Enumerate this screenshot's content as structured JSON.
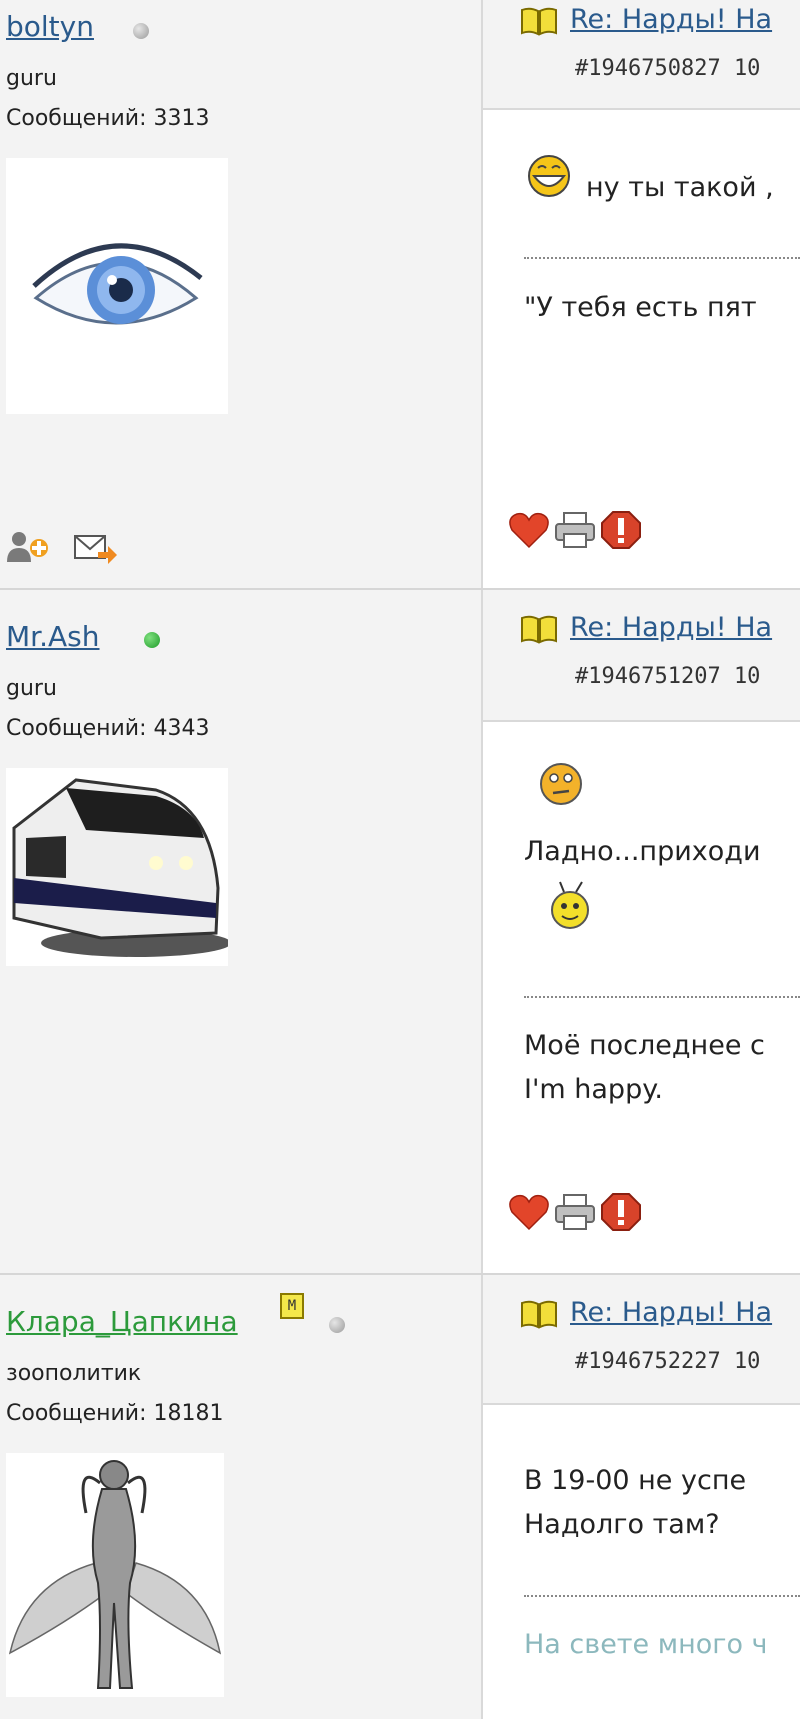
{
  "posts": [
    {
      "username": "boltyn",
      "online": false,
      "rank": "guru",
      "messages": "Сообщений: 3313",
      "title": "Re: Нарды! На",
      "post_id": "#1946750827 10",
      "text1": "ну ты такой ,",
      "sig1": "\"У тебя есть пят",
      "avatar": "eye"
    },
    {
      "username": "Mr.Ash",
      "online": true,
      "rank": "guru",
      "messages": "Сообщений: 4343",
      "title": "Re: Нарды! На",
      "post_id": "#1946751207 10",
      "text1": "Ладно...приходи",
      "sig1": "Моё последнее с",
      "sig2": "I'm happy.",
      "avatar": "train"
    },
    {
      "username": "Клара_Цапкина",
      "online": false,
      "moderator": "M",
      "rank": "зоополитик",
      "messages": "Сообщений: 18181",
      "title": "Re: Нарды! На",
      "post_id": "#1946752227 10",
      "text1": "В 19-00 не успе",
      "text2": "Надолго там?",
      "sig1": "На свете много ч",
      "avatar": "angel"
    }
  ],
  "icons": [
    "book-icon",
    "add-friend-icon",
    "send-message-icon",
    "like-heart-icon",
    "print-icon",
    "report-icon",
    "grin-smiley-icon",
    "thinking-smiley-icon",
    "bee-smiley-icon",
    "online-status-icon",
    "offline-status-icon",
    "moderator-badge-icon"
  ]
}
